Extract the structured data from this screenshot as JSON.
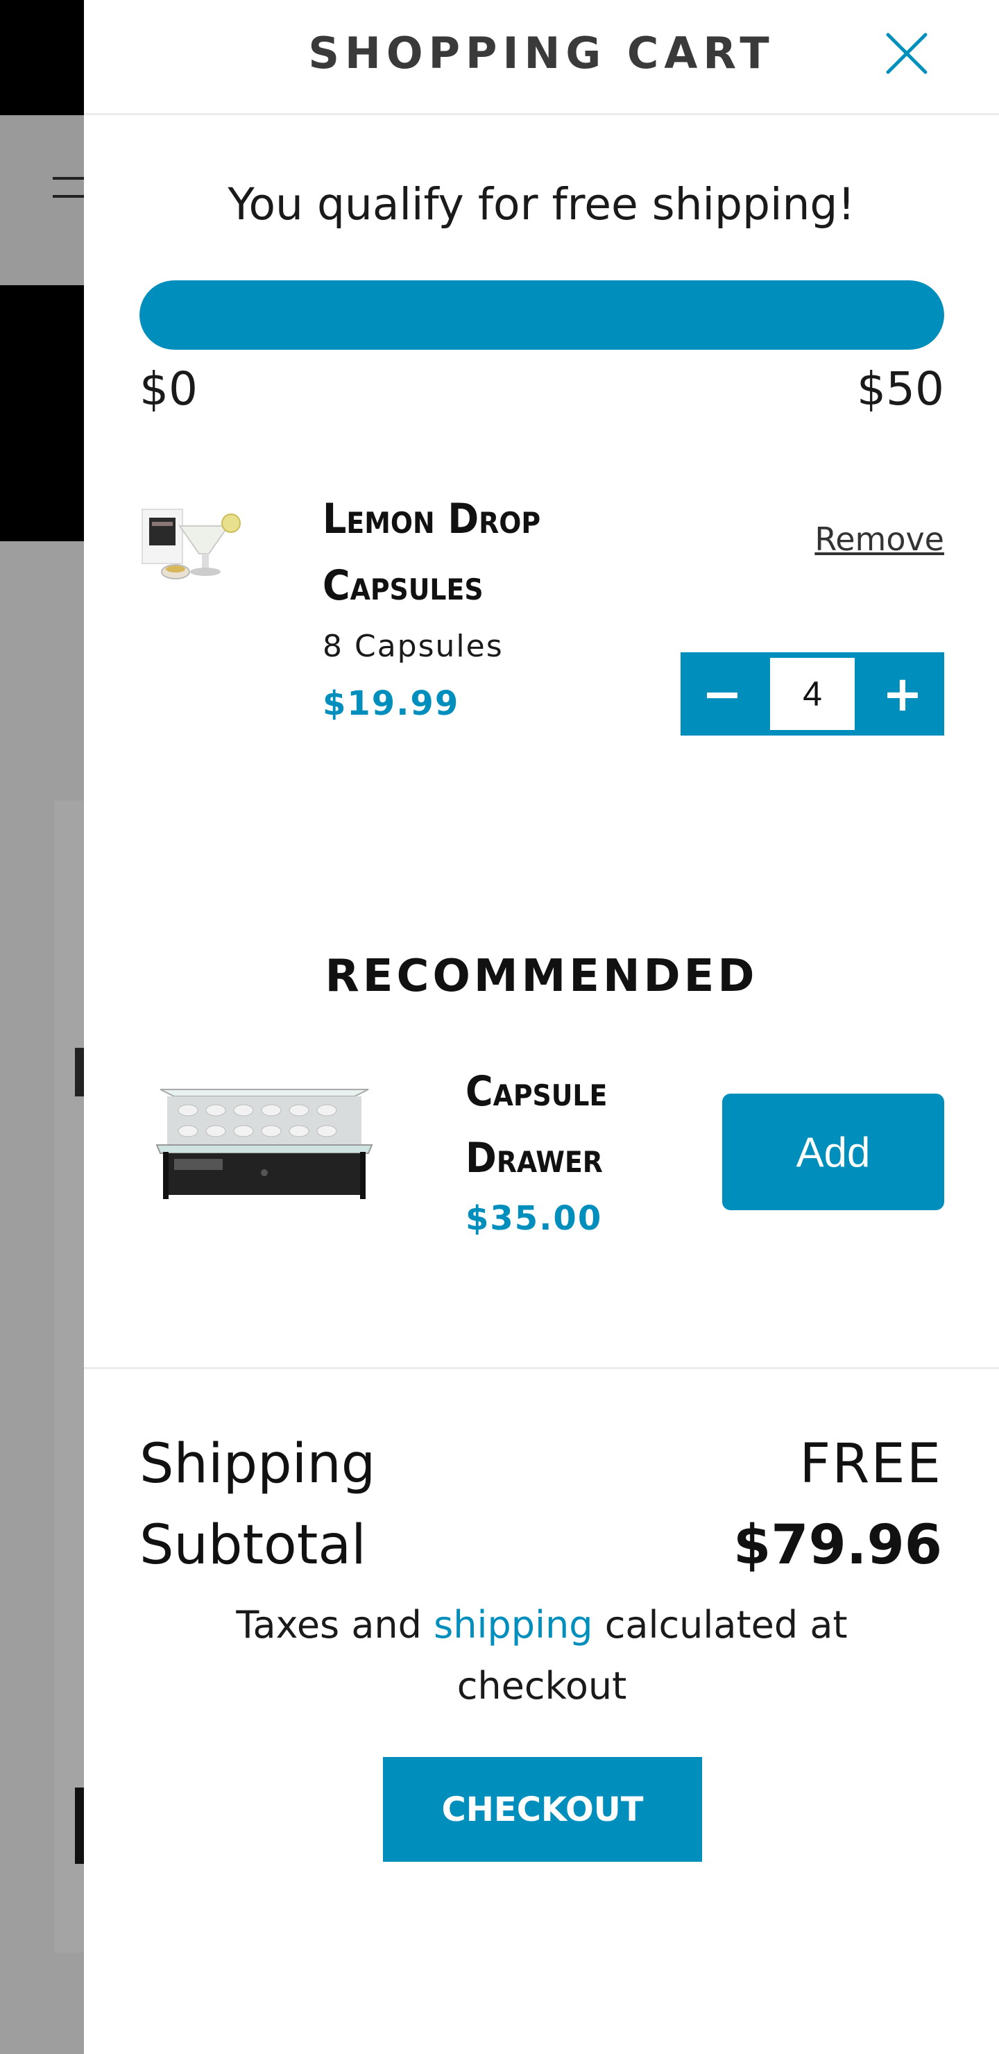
{
  "header": {
    "title": "SHOPPING CART",
    "close_icon": "close-icon"
  },
  "shipping_progress": {
    "message": "You qualify for free shipping!",
    "min_label": "$0",
    "max_label": "$50",
    "fill_fraction": 1.0
  },
  "cart_item": {
    "name": "Lemon Drop Capsules",
    "variant": "8 Capsules",
    "price": "$19.99",
    "remove_label": "Remove",
    "quantity": "4",
    "decrease_label": "−",
    "increase_label": "+"
  },
  "recommended": {
    "title": "RECOMMENDED",
    "item": {
      "name": "Capsule Drawer",
      "price": "$35.00",
      "add_label": "Add"
    }
  },
  "summary": {
    "shipping_label": "Shipping",
    "shipping_value": "FREE",
    "subtotal_label": "Subtotal",
    "subtotal_value": "$79.96",
    "tax_note_before": "Taxes and ",
    "tax_note_link": "shipping",
    "tax_note_after": " calculated at checkout"
  },
  "checkout": {
    "label": "CHECKOUT"
  },
  "colors": {
    "accent": "#008fbc",
    "overlay": "#9e9e9e"
  }
}
